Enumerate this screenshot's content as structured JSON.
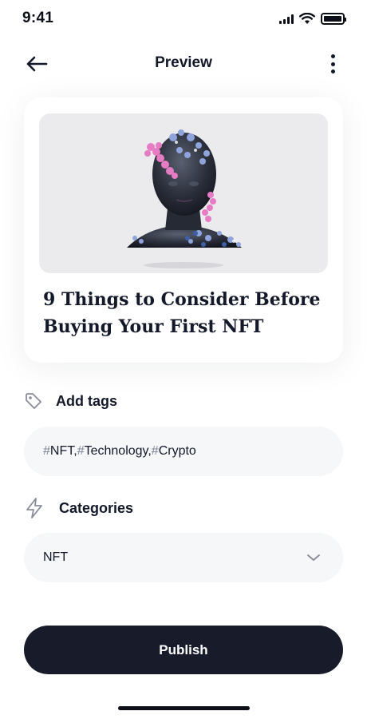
{
  "status_bar": {
    "time": "9:41"
  },
  "header": {
    "title": "Preview",
    "back_icon": "arrow-left-icon",
    "more_icon": "more-vertical-icon"
  },
  "article": {
    "title": "9 Things to Consider Before Buying Your First NFT",
    "image_description": "3D sculpted head with colorful flowers"
  },
  "tags": {
    "label": "Add tags",
    "icon": "tag-icon",
    "items": [
      {
        "hash": "#",
        "text": "NFT, "
      },
      {
        "hash": "#",
        "text": "Technology, "
      },
      {
        "hash": "#",
        "text": "Crypto"
      }
    ]
  },
  "categories": {
    "label": "Categories",
    "icon": "lightning-icon",
    "selected": "NFT",
    "dropdown_icon": "chevron-down-icon"
  },
  "actions": {
    "publish_label": "Publish"
  },
  "colors": {
    "text_primary": "#14192a",
    "button_bg": "#181b2a",
    "field_bg": "#f6f7f9",
    "image_bg": "#ebebed"
  }
}
